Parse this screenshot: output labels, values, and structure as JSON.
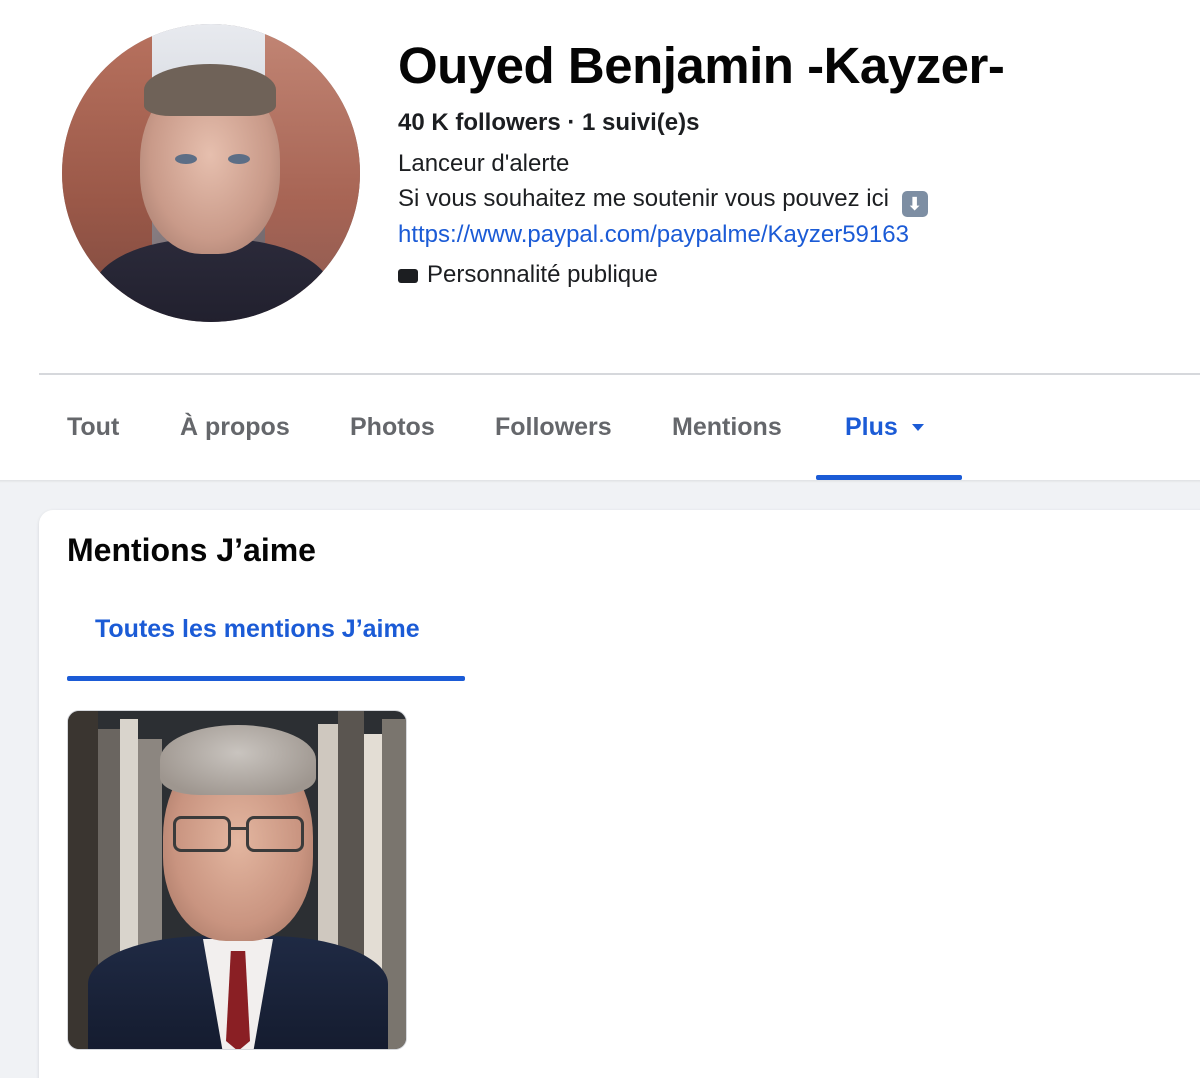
{
  "profile": {
    "name": "Ouyed Benjamin -Kayzer-",
    "stats": "40 K followers · 1 suivi(e)s",
    "bio_line_1": "Lanceur d'alerte",
    "bio_line_2": "Si vous souhaitez me soutenir vous pouvez ici",
    "bio_link": "https://www.paypal.com/paypalme/Kayzer59163",
    "category": "Personnalité publique",
    "down_arrow_emoji": "⬇"
  },
  "tabs": [
    {
      "label": "Tout"
    },
    {
      "label": "À propos"
    },
    {
      "label": "Photos"
    },
    {
      "label": "Followers"
    },
    {
      "label": "Mentions"
    },
    {
      "label": "Plus",
      "active": true
    }
  ],
  "likes_section": {
    "title": "Mentions J’aime",
    "subtab": "Toutes les mentions J’aime"
  },
  "colors": {
    "accent": "#1b5bd6",
    "inactive_tab": "#65676b",
    "page_bg": "#f0f2f5"
  },
  "icons": [
    "clapperboard-icon",
    "down-arrow-emoji",
    "caret-down-icon"
  ]
}
